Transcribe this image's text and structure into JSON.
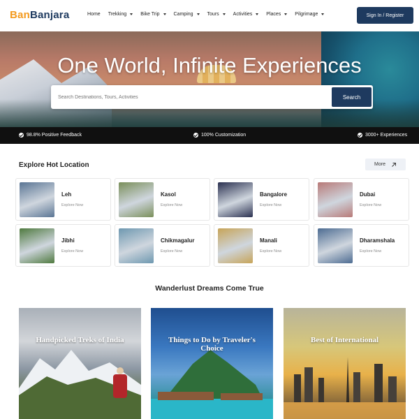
{
  "brand": {
    "part1": "Ban",
    "part2": "Banjara"
  },
  "nav": [
    {
      "label": "Home",
      "has_caret": false
    },
    {
      "label": "Trekking",
      "has_caret": true
    },
    {
      "label": "Bike Trip",
      "has_caret": true
    },
    {
      "label": "Camping",
      "has_caret": true
    },
    {
      "label": "Tours",
      "has_caret": true
    },
    {
      "label": "Activities",
      "has_caret": true
    },
    {
      "label": "Places",
      "has_caret": true
    },
    {
      "label": "Pilgrimage",
      "has_caret": true
    }
  ],
  "signin_label": "Sign In / Register",
  "hero": {
    "title": "One World, Infinite Experiences",
    "search_placeholder": "Search Destinations, Tours, Activities",
    "search_button": "Search"
  },
  "features": [
    "98.8% Positive Feedback",
    "100% Customization",
    "3000+ Experiences"
  ],
  "explore": {
    "title": "Explore Hot Location",
    "more_label": "More",
    "cta": "Explore Now",
    "locations": [
      {
        "name": "Leh",
        "color": "#5a7594"
      },
      {
        "name": "Kasol",
        "color": "#7a8f5a"
      },
      {
        "name": "Bangalore",
        "color": "#2a3050"
      },
      {
        "name": "Dubai",
        "color": "#b87a78"
      },
      {
        "name": "Jibhi",
        "color": "#4f7a3f"
      },
      {
        "name": "Chikmagalur",
        "color": "#6e98b0"
      },
      {
        "name": "Manali",
        "color": "#c7a458"
      },
      {
        "name": "Dharamshala",
        "color": "#4d6c92"
      }
    ]
  },
  "dreams": {
    "title": "Wanderlust Dreams Come True",
    "cards": [
      {
        "title": "Handpicked Treks of India"
      },
      {
        "title": "Things to Do by Traveler's Choice"
      },
      {
        "title": "Best of International"
      }
    ]
  },
  "colors": {
    "brand_orange": "#f39a1e",
    "brand_navy": "#1e3a5f",
    "feature_bar": "#101010"
  }
}
